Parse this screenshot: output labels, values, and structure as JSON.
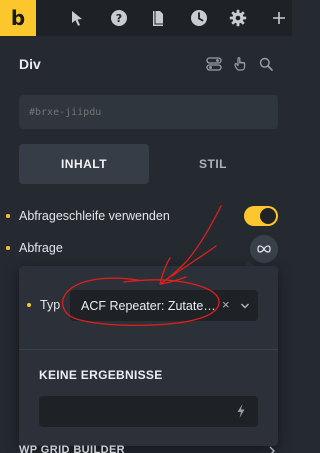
{
  "toolbar": {
    "logo": "b",
    "icons": [
      "cursor-icon",
      "help-icon",
      "pages-icon",
      "history-icon",
      "settings-icon",
      "add-icon"
    ]
  },
  "panel": {
    "title": "Div",
    "css_id": "#brxe-jiipdu"
  },
  "tabs": {
    "content": "INHALT",
    "style": "STIL"
  },
  "controls": {
    "use_query_loop_label": "Abfrageschleife verwenden",
    "use_query_loop_enabled": true,
    "query_label": "Abfrage"
  },
  "query_popup": {
    "type_label": "Typ",
    "type_value": "ACF Repeater: Zutate…",
    "clear_glyph": "×",
    "no_results_heading": "KEINE ERGEBNISSE"
  },
  "cut_off_section": "WP GRID BUILDER",
  "colors": {
    "accent": "#fcc72d",
    "panel_bg": "#252a31",
    "annotation": "#e0201a"
  }
}
